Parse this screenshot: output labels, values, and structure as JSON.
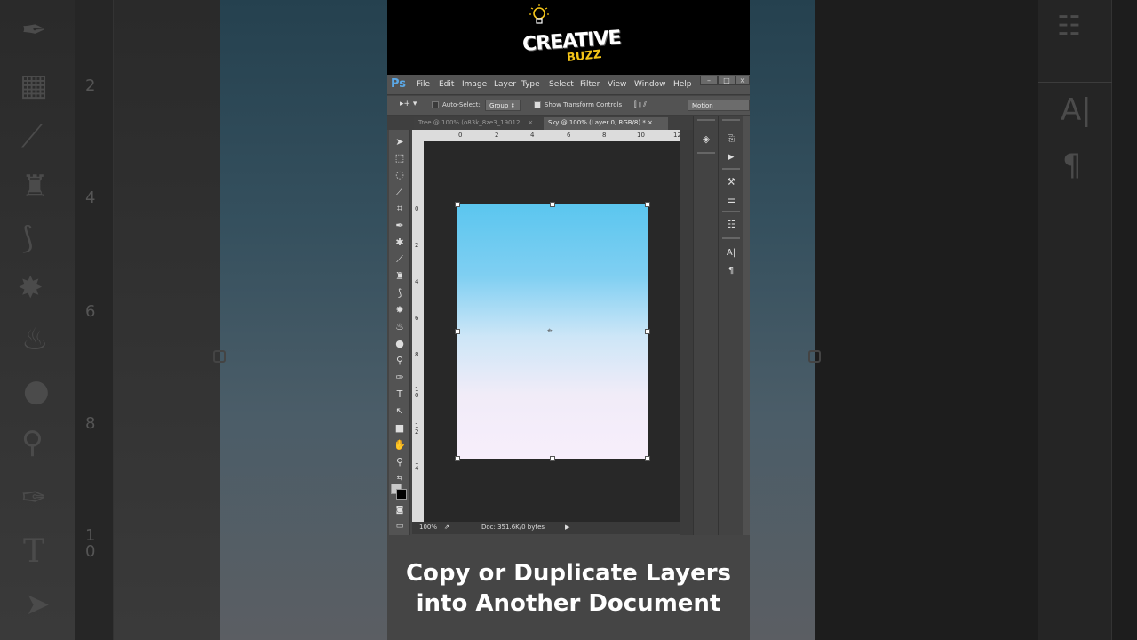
{
  "branding": {
    "logo_main": "CREATIVE",
    "logo_sub": "BUZZ"
  },
  "app": {
    "logo": "Ps",
    "menu": [
      "File",
      "Edit",
      "Image",
      "Layer",
      "Type",
      "Select",
      "Filter",
      "View",
      "Window",
      "Help"
    ]
  },
  "options": {
    "auto_select_label": "Auto-Select:",
    "auto_select_value": "Group",
    "transform_label": "Show Transform Controls",
    "workspace": "Motion"
  },
  "tabs": [
    {
      "label": "Tree @ 100% (o83k_8ze3_19012...",
      "close": "×",
      "active": false
    },
    {
      "label": "Sky @ 100% (Layer 0, RGB/8) *",
      "close": "×",
      "active": true
    }
  ],
  "rulers": {
    "top": [
      "0",
      "2",
      "4",
      "6",
      "8",
      "10",
      "12"
    ],
    "left": [
      "0",
      "2",
      "4",
      "6",
      "8",
      "1\n0",
      "1\n2",
      "1\n4"
    ]
  },
  "status": {
    "zoom": "100%",
    "doc": "Doc: 351.6K/0 bytes"
  },
  "caption": {
    "line1": "Copy or Duplicate Layers",
    "line2": "into Another Document"
  },
  "ghost": {
    "left_ticks": [
      "2",
      "4",
      "6",
      "8",
      "1\n0"
    ]
  }
}
